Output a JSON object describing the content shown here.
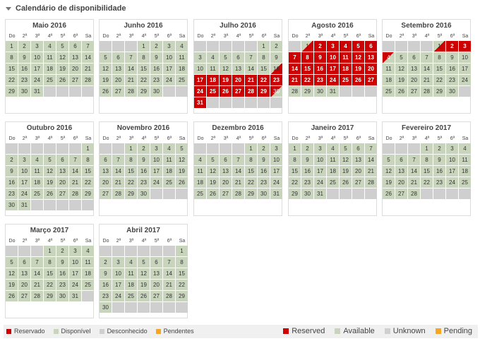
{
  "header": {
    "title": "Calendário de disponibilidade"
  },
  "day_names": [
    "Do",
    "2ª",
    "3ª",
    "4ª",
    "5ª",
    "6ª",
    "Sa"
  ],
  "months": [
    {
      "name": "Maio 2016",
      "start": 0,
      "days": 31,
      "def": "a",
      "special": {}
    },
    {
      "name": "Junho 2016",
      "start": 3,
      "days": 30,
      "def": "a",
      "special": {}
    },
    {
      "name": "Julho 2016",
      "start": 5,
      "days": 31,
      "def": "a",
      "special": {
        "16": "hr",
        "17": "r",
        "18": "r",
        "19": "r",
        "20": "r",
        "21": "r",
        "22": "r",
        "23": "r",
        "24": "r",
        "25": "r",
        "26": "r",
        "27": "r",
        "28": "r",
        "29": "r",
        "30": "hl",
        "31": "r"
      }
    },
    {
      "name": "Agosto 2016",
      "start": 1,
      "days": 31,
      "def": "r",
      "special": {
        "1": "hr",
        "28": "a",
        "29": "a",
        "30": "a",
        "31": "a"
      }
    },
    {
      "name": "Setembro 2016",
      "start": 4,
      "days": 30,
      "def": "a",
      "special": {
        "1": "hr",
        "2": "r",
        "3": "r",
        "4": "hl"
      }
    },
    {
      "name": "Outubro 2016",
      "start": 6,
      "days": 31,
      "def": "a",
      "special": {}
    },
    {
      "name": "Novembro 2016",
      "start": 2,
      "days": 30,
      "def": "a",
      "special": {}
    },
    {
      "name": "Dezembro 2016",
      "start": 4,
      "days": 31,
      "def": "a",
      "special": {}
    },
    {
      "name": "Janeiro 2017",
      "start": 0,
      "days": 31,
      "def": "a",
      "special": {}
    },
    {
      "name": "Fevereiro 2017",
      "start": 3,
      "days": 28,
      "def": "a",
      "special": {}
    },
    {
      "name": "Março 2017",
      "start": 3,
      "days": 31,
      "def": "a",
      "special": {}
    },
    {
      "name": "Abril 2017",
      "start": 6,
      "days": 30,
      "def": "a",
      "special": {}
    }
  ],
  "legend_left": [
    {
      "label": "Reservado",
      "color": "#cc0000"
    },
    {
      "label": "Disponível",
      "color": "#c8d4bb"
    },
    {
      "label": "Desconhecido",
      "color": "#cfcfcf"
    },
    {
      "label": "Pendentes",
      "color": "#f5a623"
    }
  ],
  "legend_right": [
    {
      "label": "Reserved",
      "color": "#cc0000"
    },
    {
      "label": "Available",
      "color": "#c8d4bb"
    },
    {
      "label": "Unknown",
      "color": "#cfcfcf"
    },
    {
      "label": "Pending",
      "color": "#f5a623"
    }
  ]
}
